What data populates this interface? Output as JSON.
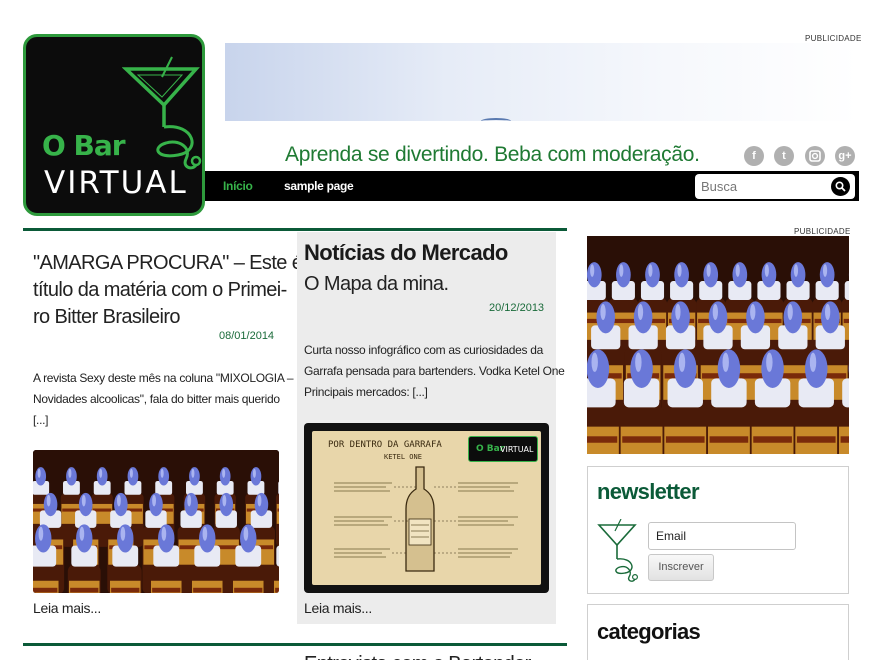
{
  "logo": {
    "top_word": "O Bar",
    "bottom_word": "VIRTUAL"
  },
  "header": {
    "ad_label": "PUBLICIDADE",
    "tagline": "Aprenda se divertindo. Beba com moderação.",
    "social": [
      "facebook-icon",
      "twitter-icon",
      "instagram-icon",
      "google-plus-icon"
    ]
  },
  "nav": {
    "items": [
      {
        "label": "Início",
        "active": true
      },
      {
        "label": "sample page",
        "active": false
      }
    ],
    "search_placeholder": "Busca"
  },
  "posts": {
    "left": {
      "title_lines": [
        "\"AMARGA PROCURA\" – Este é o",
        "título da matéria com o Primei-",
        "ro Bitter Brasileiro"
      ],
      "date": "08/01/2014",
      "excerpt_lines": [
        "A revista Sexy deste mês na coluna \"MIXOLOGIA –",
        "Novidades alcoolicas\", fala do bitter mais querido",
        "[...]"
      ],
      "read_more": "Leia mais..."
    },
    "middle": {
      "section_title": "Notícias do Mercado",
      "title": "O Mapa da mina.",
      "date": "20/12/2013",
      "excerpt_lines": [
        "Curta nosso infográfico com as curiosidades da",
        "Garrafa pensada para bartenders. Vodka Ketel One",
        "Principais mercados: [...]"
      ],
      "read_more": "Leia mais...",
      "infographic": {
        "heading": "POR DENTRO DA GARRAFA",
        "subheading": "KETEL ONE",
        "logo_top": "O Bar",
        "logo_bottom": "VIRTUAL"
      }
    },
    "next_partial": "Entrevista com o Bartender"
  },
  "sidebar": {
    "ad_label": "PUBLICIDADE",
    "newsletter": {
      "title": "newsletter",
      "email_placeholder": "Email",
      "button": "Inscrever"
    },
    "categories": {
      "title": "categorias"
    }
  },
  "colors": {
    "brand_green": "#37b34a",
    "dark_green": "#0b5a38",
    "tagline_green": "#1f7a33",
    "nav_bg": "#000000"
  }
}
